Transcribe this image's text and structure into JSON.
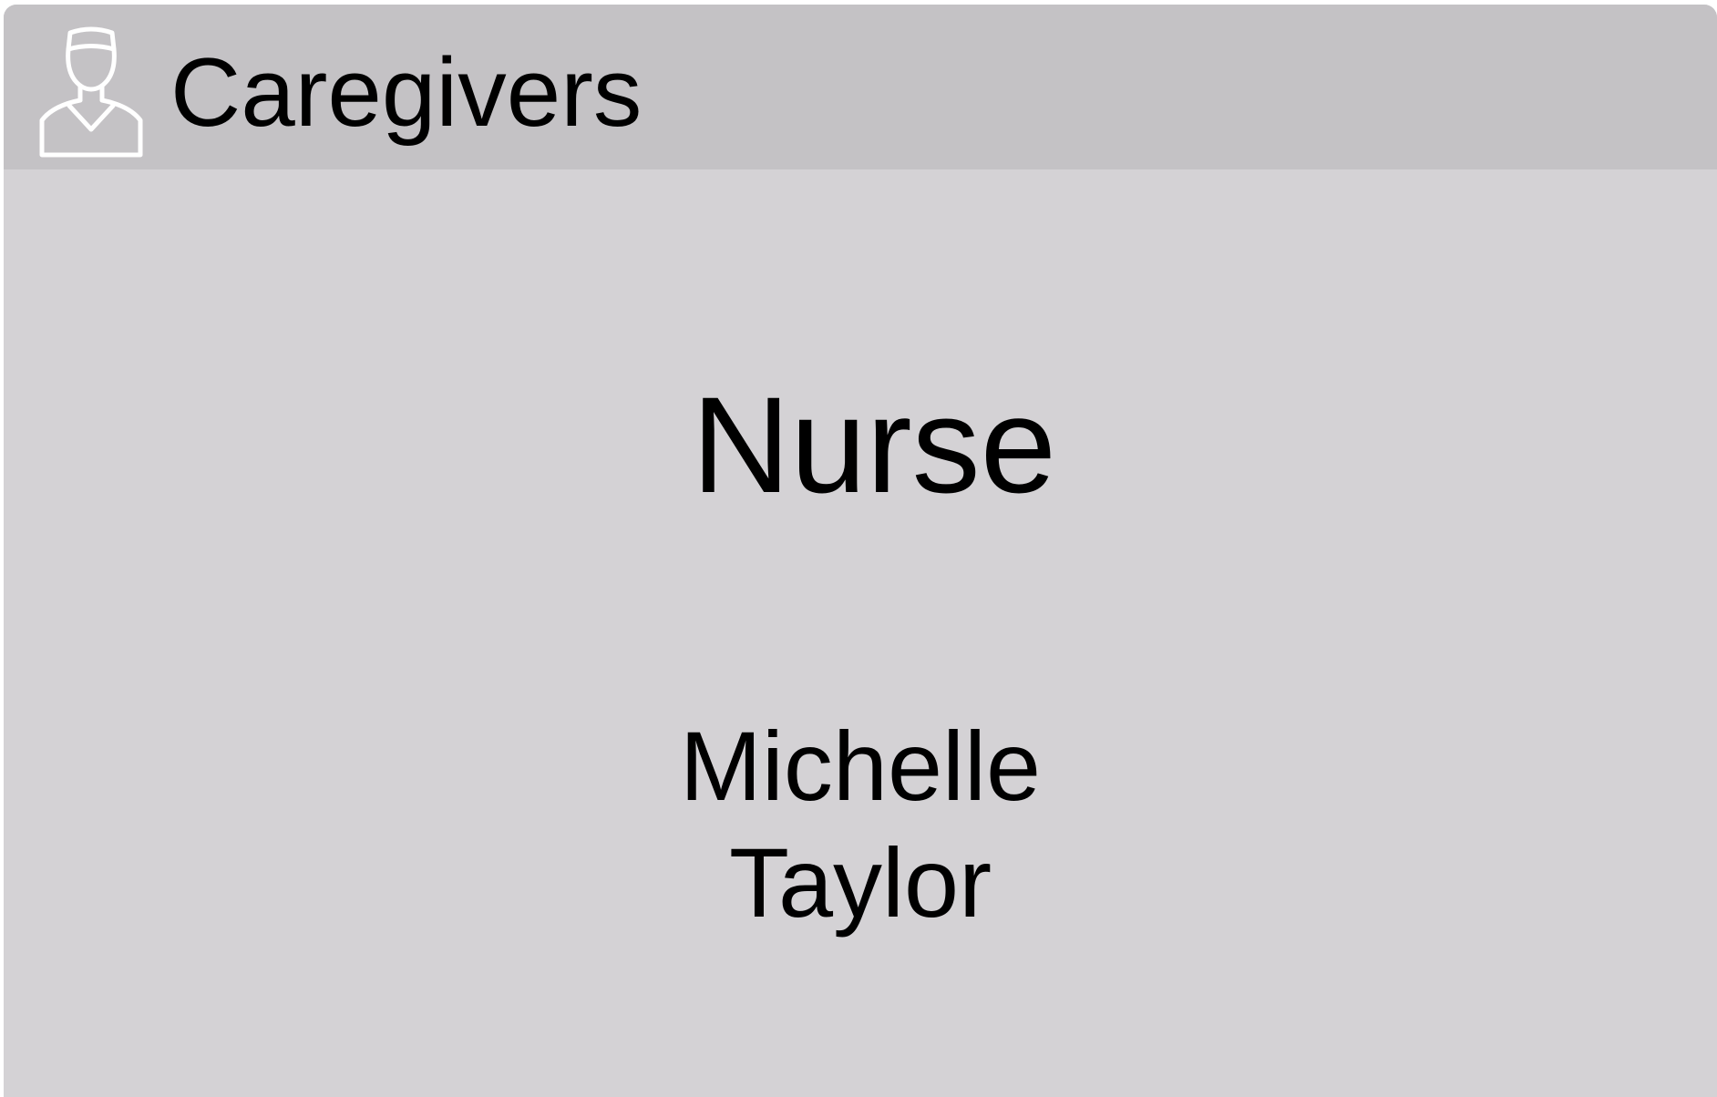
{
  "header": {
    "icon": "nurse-icon",
    "title": "Caregivers"
  },
  "caregiver": {
    "role": "Nurse",
    "first_name": "Michelle",
    "last_name": "Taylor"
  },
  "colors": {
    "header_background": "#c4c2c5",
    "card_background": "#d4d2d5",
    "icon_stroke": "#ffffff",
    "text": "#000000"
  }
}
